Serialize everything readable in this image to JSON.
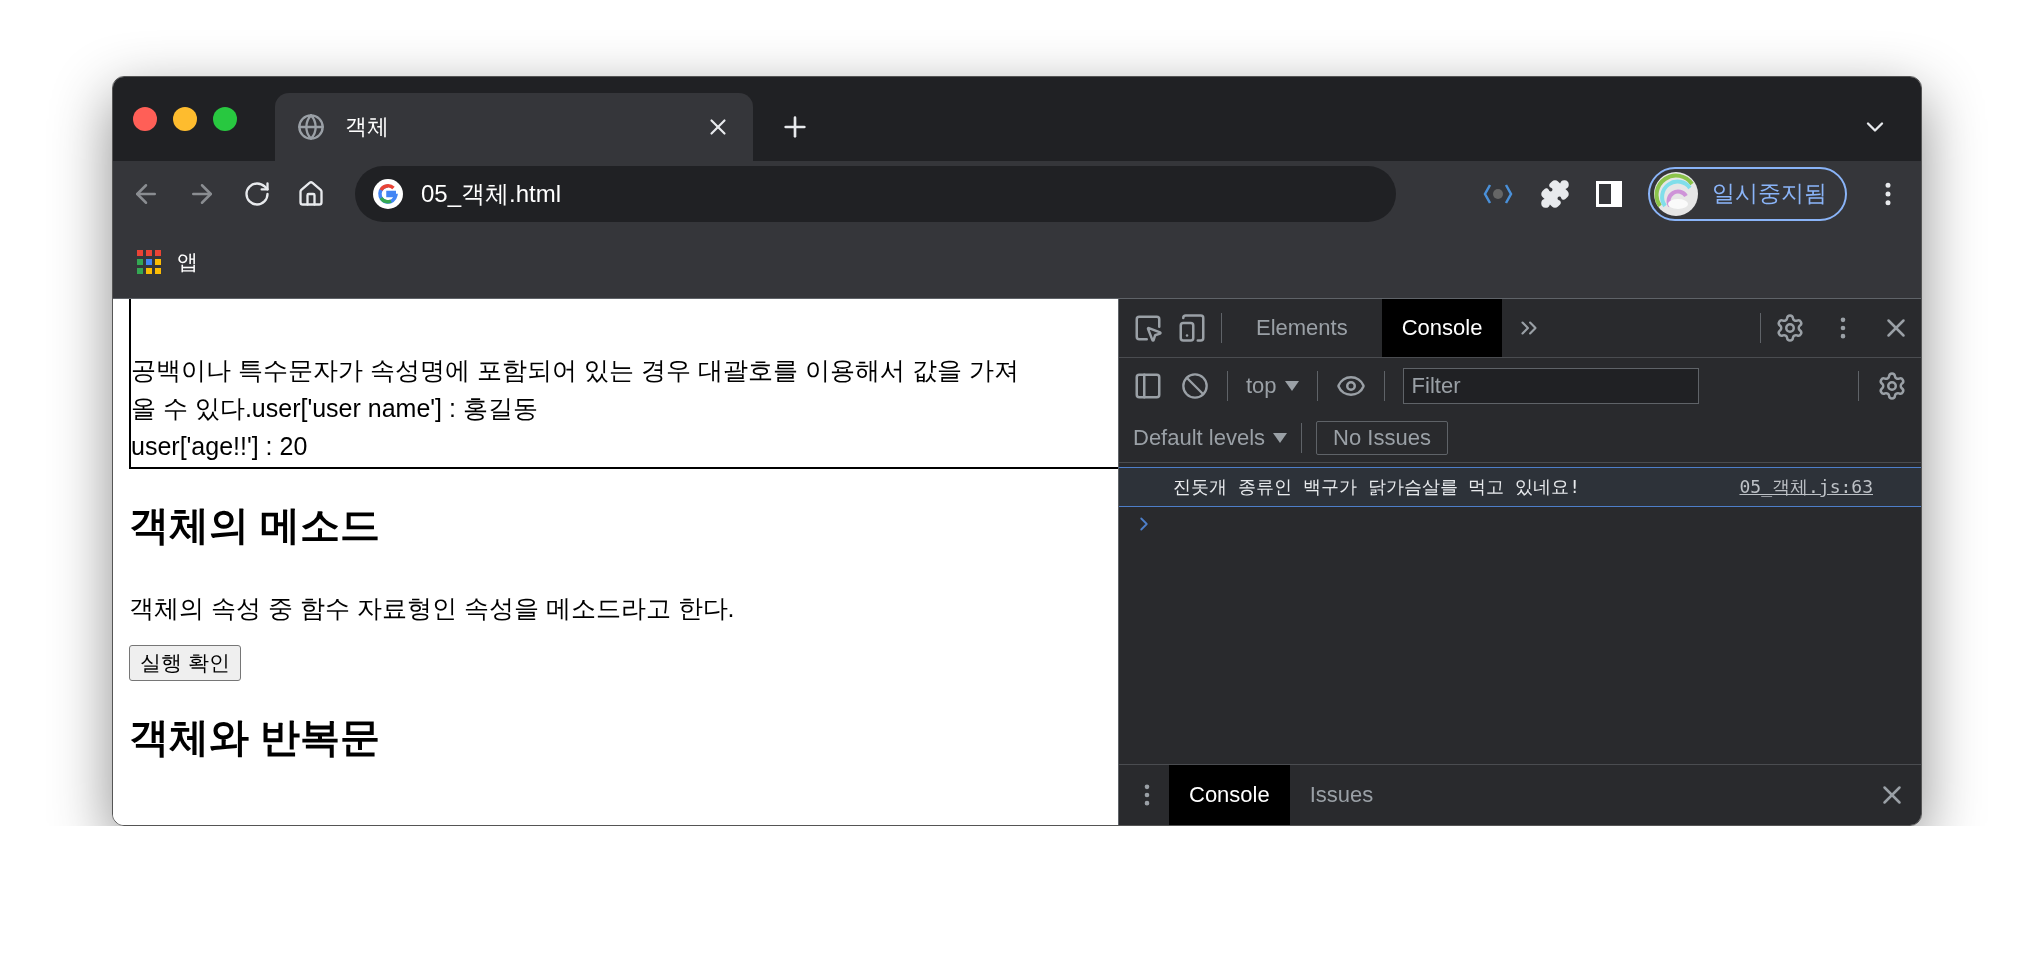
{
  "browser_tabs": [
    {
      "title": "객체",
      "selected": true
    }
  ],
  "address": "05_객체.html",
  "profile": {
    "label": "일시중지됨"
  },
  "bookmarks": [
    {
      "label": "앱"
    }
  ],
  "page": {
    "box_lines": [
      "공백이나 특수문자가 속성명에 포함되어 있는 경우 대괄호를 이용해서 값을 가져",
      "올 수 있다.user['user name'] : 홍길동",
      "user['age!!'] : 20"
    ],
    "heading": "객체의 메소드",
    "paragraph": "객체의 속성 중 함수 자료형인 속성을 메소드라고 한다.",
    "button": "실행 확인",
    "heading_2": "객체와 반복문"
  },
  "devtools": {
    "tabs": [
      {
        "label": "Elements",
        "selected": false
      },
      {
        "label": "Console",
        "selected": true
      }
    ],
    "context": "top",
    "filter": {
      "placeholder": "Filter"
    },
    "levels": "Default levels",
    "issues": "No Issues",
    "messages": [
      {
        "text": "진돗개 종류인 백구가 닭가슴살를 먹고 있네요!",
        "source": "05_객체.js:63"
      }
    ],
    "drawer_tabs": [
      {
        "label": "Console",
        "selected": true
      },
      {
        "label": "Issues",
        "selected": false
      }
    ]
  }
}
